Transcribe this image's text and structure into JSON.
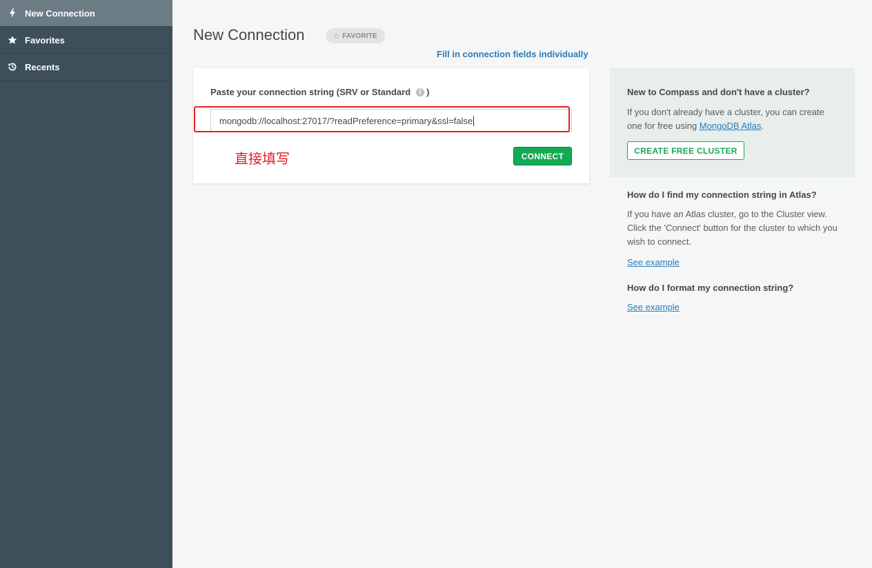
{
  "sidebar": {
    "items": [
      {
        "label": "New Connection",
        "icon": "bolt-icon",
        "active": true
      },
      {
        "label": "Favorites",
        "icon": "star-icon",
        "active": false
      },
      {
        "label": "Recents",
        "icon": "history-icon",
        "active": false
      }
    ]
  },
  "main": {
    "title": "New Connection",
    "favorite_label": "FAVORITE",
    "fill_link": "Fill in connection fields individually",
    "card": {
      "label": "Paste your connection string (SRV or Standard",
      "label_close": ")",
      "input_value": "mongodb://localhost:27017/?readPreference=primary&ssl=false",
      "annotation": "直接填写",
      "connect_label": "CONNECT"
    }
  },
  "help": {
    "cluster_heading": "New to Compass and don't have a cluster?",
    "cluster_text": "If you don't already have a cluster, you can create one for free using ",
    "atlas_link": "MongoDB Atlas",
    "cluster_text_end": ".",
    "create_cluster_label": "CREATE FREE CLUSTER",
    "find_heading": "How do I find my connection string in Atlas?",
    "find_text": "If you have an Atlas cluster, go to the Cluster view. Click the 'Connect' button for the cluster to which you wish to connect.",
    "see_example_1": "See example",
    "format_heading": "How do I format my connection string?",
    "see_example_2": "See example"
  },
  "colors": {
    "sidebar_bg": "#3d4f58",
    "sidebar_active": "#6b7c85",
    "accent_green": "#13aa52",
    "link_blue": "#2c7cb8",
    "annotation_red": "#e02020"
  }
}
